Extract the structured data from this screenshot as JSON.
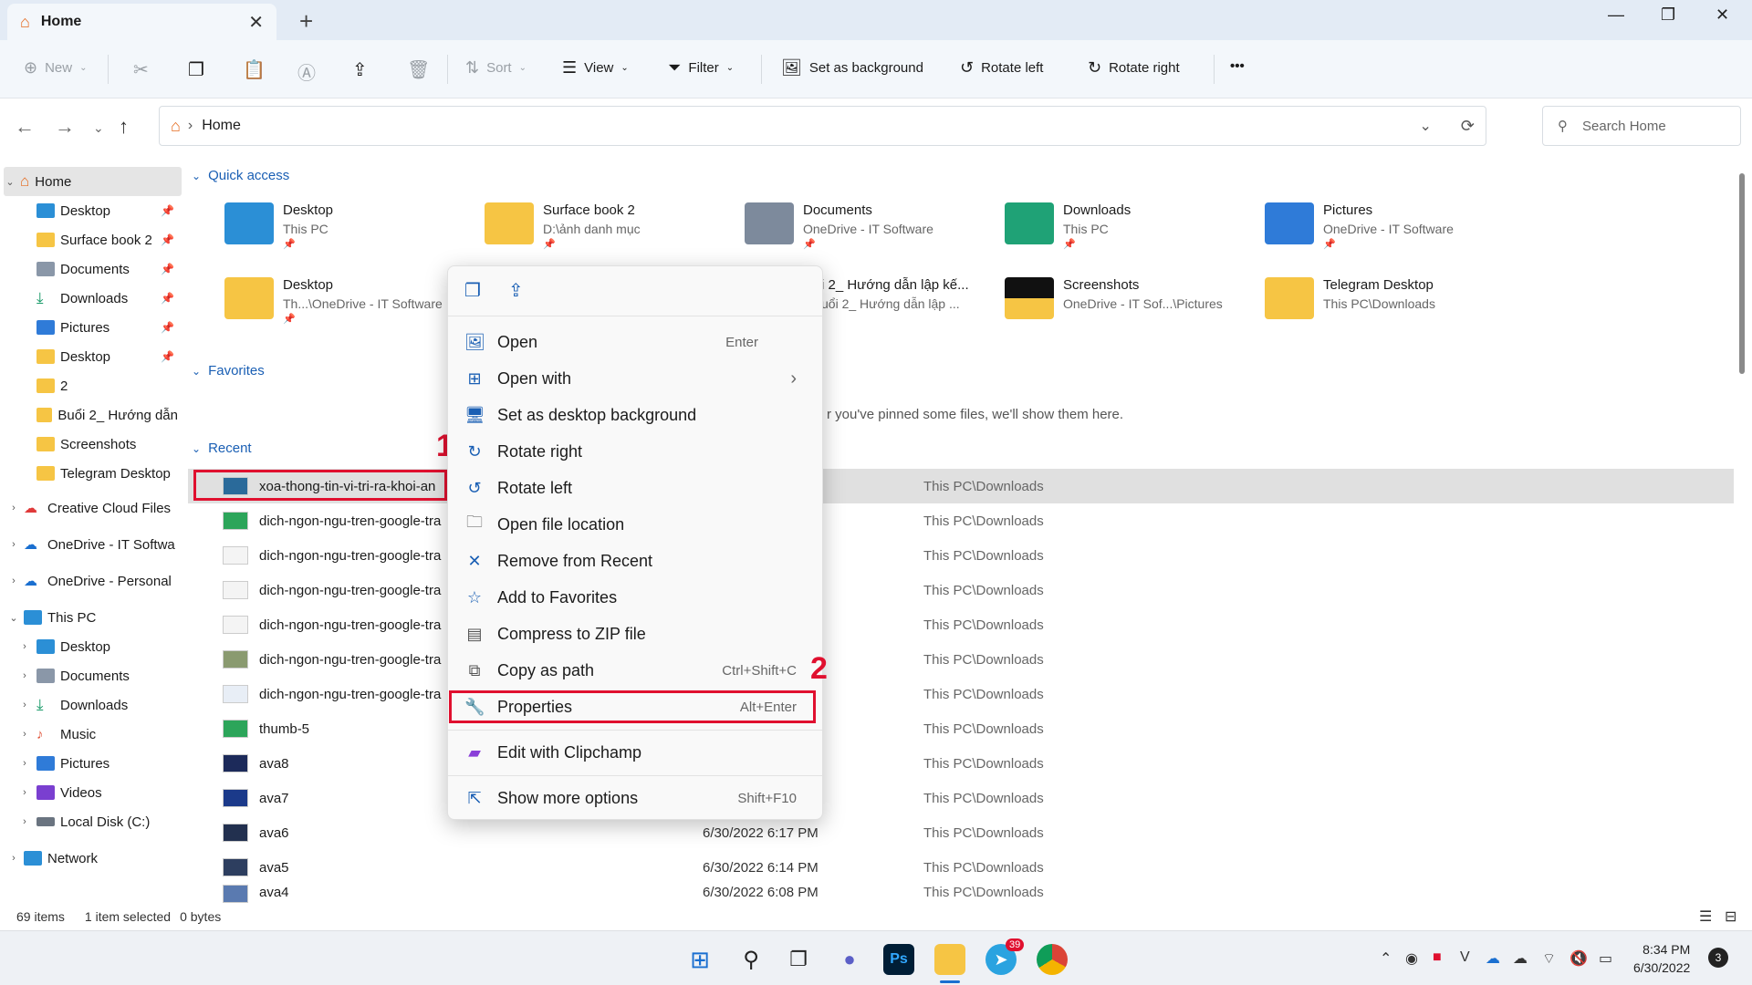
{
  "window": {
    "tab_title": "Home",
    "tab_close": "✕",
    "new_tab": "+",
    "minimize": "—",
    "maximize": "❐",
    "close": "✕"
  },
  "toolbar": {
    "new": "New",
    "sort": "Sort",
    "view": "View",
    "filter": "Filter",
    "set_background": "Set as background",
    "rotate_left": "Rotate left",
    "rotate_right": "Rotate right",
    "more": "•••"
  },
  "address": {
    "path": "Home",
    "search_placeholder": "Search Home"
  },
  "sidebar": {
    "items": [
      {
        "label": "Home"
      },
      {
        "label": "Desktop"
      },
      {
        "label": "Surface book 2"
      },
      {
        "label": "Documents"
      },
      {
        "label": "Downloads"
      },
      {
        "label": "Pictures"
      },
      {
        "label": "Desktop"
      },
      {
        "label": "2"
      },
      {
        "label": "Buổi 2_ Hướng dẫn"
      },
      {
        "label": "Screenshots"
      },
      {
        "label": "Telegram Desktop"
      },
      {
        "label": "Creative Cloud Files"
      },
      {
        "label": "OneDrive - IT Softwa"
      },
      {
        "label": "OneDrive - Personal"
      },
      {
        "label": "This PC"
      },
      {
        "label": "Desktop"
      },
      {
        "label": "Documents"
      },
      {
        "label": "Downloads"
      },
      {
        "label": "Music"
      },
      {
        "label": "Pictures"
      },
      {
        "label": "Videos"
      },
      {
        "label": "Local Disk (C:)"
      },
      {
        "label": "Network"
      }
    ]
  },
  "main": {
    "quick_access_label": "Quick access",
    "favorites_label": "Favorites",
    "favorites_empty": "r you've pinned some files, we'll show them here.",
    "recent_label": "Recent",
    "quick_access": [
      {
        "name": "Desktop",
        "sub": "This PC"
      },
      {
        "name": "Surface book 2",
        "sub": "D:\\ảnh danh mục"
      },
      {
        "name": "Documents",
        "sub": "OneDrive - IT Software"
      },
      {
        "name": "Downloads",
        "sub": "This PC"
      },
      {
        "name": "Pictures",
        "sub": "OneDrive - IT Software"
      },
      {
        "name": "Desktop",
        "sub": "Th...\\OneDrive - IT Software"
      },
      {
        "name": "i 2_ Hướng dẫn lập kế...",
        "sub": "uổi 2_ Hướng dẫn lập ..."
      },
      {
        "name": "Screenshots",
        "sub": "OneDrive - IT Sof...\\Pictures"
      },
      {
        "name": "Telegram Desktop",
        "sub": "This PC\\Downloads"
      }
    ],
    "recent": [
      {
        "name": "xoa-thong-tin-vi-tri-ra-khoi-an",
        "date": "",
        "loc": "This PC\\Downloads"
      },
      {
        "name": "dich-ngon-ngu-tren-google-tra",
        "date": "",
        "loc": "This PC\\Downloads"
      },
      {
        "name": "dich-ngon-ngu-tren-google-tra",
        "date": "",
        "loc": "This PC\\Downloads"
      },
      {
        "name": "dich-ngon-ngu-tren-google-tra",
        "date": "",
        "loc": "This PC\\Downloads"
      },
      {
        "name": "dich-ngon-ngu-tren-google-tra",
        "date": "",
        "loc": "This PC\\Downloads"
      },
      {
        "name": "dich-ngon-ngu-tren-google-tra",
        "date": "",
        "loc": "This PC\\Downloads"
      },
      {
        "name": "dich-ngon-ngu-tren-google-tra",
        "date": "",
        "loc": "This PC\\Downloads"
      },
      {
        "name": "thumb-5",
        "date": "",
        "loc": "This PC\\Downloads"
      },
      {
        "name": "ava8",
        "date": "",
        "loc": "This PC\\Downloads"
      },
      {
        "name": "ava7",
        "date": "",
        "loc": "This PC\\Downloads"
      },
      {
        "name": "ava6",
        "date": "6/30/2022 6:17 PM",
        "loc": "This PC\\Downloads"
      },
      {
        "name": "ava5",
        "date": "6/30/2022 6:14 PM",
        "loc": "This PC\\Downloads"
      },
      {
        "name": "ava4",
        "date": "6/30/2022 6:08 PM",
        "loc": "This PC\\Downloads"
      }
    ]
  },
  "context_menu": {
    "items": [
      {
        "label": "Open",
        "shortcut": "Enter"
      },
      {
        "label": "Open with",
        "shortcut": "›"
      },
      {
        "label": "Set as desktop background",
        "shortcut": ""
      },
      {
        "label": "Rotate right",
        "shortcut": ""
      },
      {
        "label": "Rotate left",
        "shortcut": ""
      },
      {
        "label": "Open file location",
        "shortcut": ""
      },
      {
        "label": "Remove from Recent",
        "shortcut": ""
      },
      {
        "label": "Add to Favorites",
        "shortcut": ""
      },
      {
        "label": "Compress to ZIP file",
        "shortcut": ""
      },
      {
        "label": "Copy as path",
        "shortcut": "Ctrl+Shift+C"
      },
      {
        "label": "Properties",
        "shortcut": "Alt+Enter"
      },
      {
        "label": "Edit with Clipchamp",
        "shortcut": ""
      },
      {
        "label": "Show more options",
        "shortcut": "Shift+F10"
      }
    ]
  },
  "annotations": {
    "one": "1",
    "two": "2"
  },
  "status": {
    "items": "69 items",
    "selected": "1 item selected",
    "size": "0 bytes"
  },
  "taskbar": {
    "telegram_badge": "39",
    "time": "8:34 PM",
    "date": "6/30/2022",
    "notif": "3",
    "ps_label": "Ps"
  },
  "colors": {
    "accent": "#1a5fb4",
    "highlight": "#e0102f",
    "folder": "#f6c544"
  }
}
